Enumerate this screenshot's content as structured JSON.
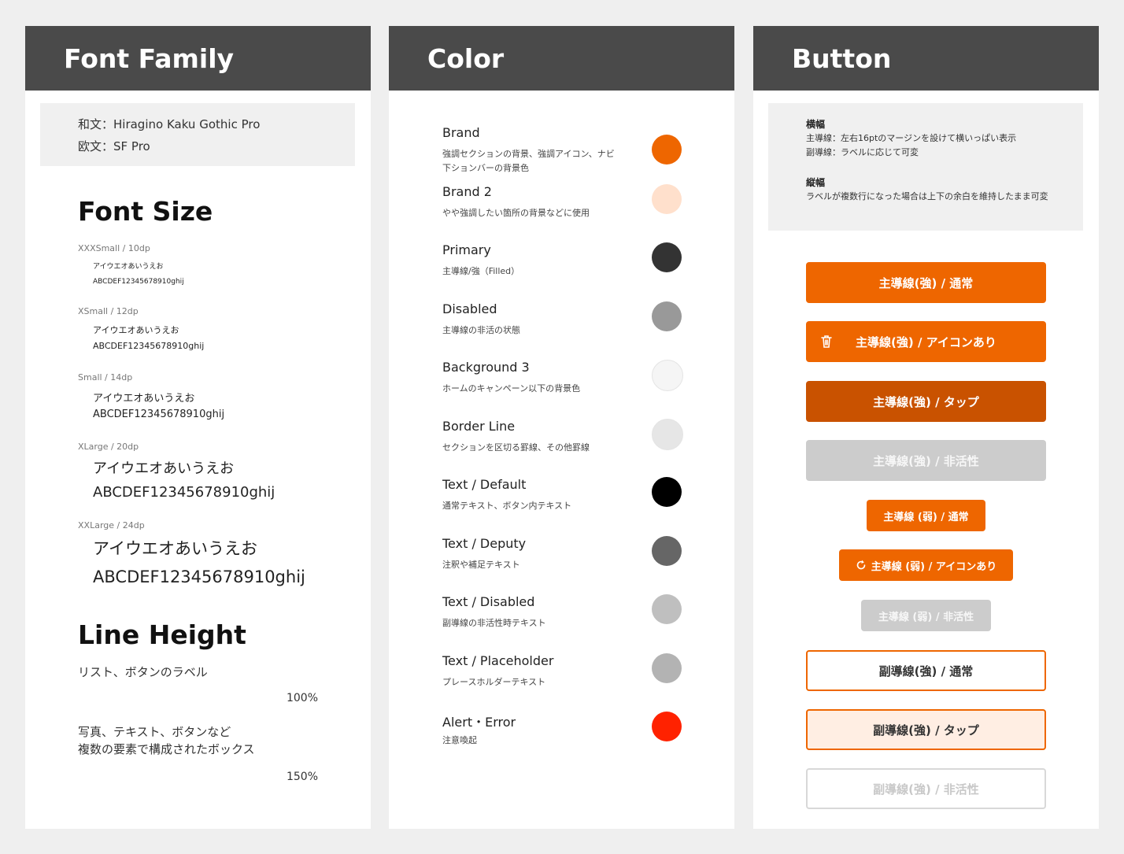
{
  "font_family": {
    "title": "Font Family",
    "japanese": "和文：Hiragino Kaku Gothic Pro",
    "latin": "欧文：SF Pro"
  },
  "font_size": {
    "title": "Font Size",
    "items": [
      {
        "label": "XXXSmall / 10dp",
        "kana": "アイウエオあいうえお",
        "alnum": "ABCDEF12345678910ghij"
      },
      {
        "label": "XSmall / 12dp",
        "kana": "アイウエオあいうえお",
        "alnum": "ABCDEF12345678910ghij"
      },
      {
        "label": "Small / 14dp",
        "kana": "アイウエオあいうえお",
        "alnum": "ABCDEF12345678910ghij"
      },
      {
        "label": "XLarge / 20dp",
        "kana": "アイウエオあいうえお",
        "alnum": "ABCDEF12345678910ghij"
      },
      {
        "label": "XXLarge / 24dp",
        "kana": "アイウエオあいうえお",
        "alnum": "ABCDEF12345678910ghij"
      }
    ]
  },
  "line_height": {
    "title": "Line Height",
    "items": [
      {
        "text1": "リスト、ボタンのラベル",
        "text2": "",
        "value": "100%"
      },
      {
        "text1": "写真、テキスト、ボタンなど",
        "text2": "複数の要素で構成されたボックス",
        "value": "150%"
      }
    ]
  },
  "color": {
    "title": "Color",
    "items": [
      {
        "name": "Brand",
        "desc": "強調セクションの背景、強調アイコン、ナビ下ションバーの背景色",
        "hex": "#ee6600"
      },
      {
        "name": "Brand 2",
        "desc": "やや強調したい箇所の背景などに使用",
        "hex": "#ffe0cc"
      },
      {
        "name": "Primary",
        "desc": "主導線/強（Filled）",
        "hex": "#333333"
      },
      {
        "name": "Disabled",
        "desc": "主導線の非活の状態",
        "hex": "#999999"
      },
      {
        "name": "Background 3",
        "desc": "ホームのキャンペーン以下の背景色",
        "hex": "#f5f5f5"
      },
      {
        "name": "Border Line",
        "desc": "セクションを区切る罫線、その他罫線",
        "hex": "#e6e6e6"
      },
      {
        "name": "Text / Default",
        "desc": "通常テキスト、ボタン内テキスト",
        "hex": "#000000"
      },
      {
        "name": "Text / Deputy",
        "desc": "注釈や補足テキスト",
        "hex": "#666666"
      },
      {
        "name": "Text / Disabled",
        "desc": "副導線の非活性時テキスト",
        "hex": "#bfbfbf"
      },
      {
        "name": "Text / Placeholder",
        "desc": "プレースホルダーテキスト",
        "hex": "#b3b3b3"
      },
      {
        "name": "Alert・Error",
        "desc": "注意喚起",
        "hex": "#ff2200"
      }
    ]
  },
  "button": {
    "title": "Button",
    "width_title": "横幅",
    "width_line1": "主導線：左右16ptのマージンを設けて横いっぱい表示",
    "width_line2": "副導線：ラベルに応じて可変",
    "height_title": "縦幅",
    "height_desc": "ラベルが複数行になった場合は上下の余白を維持したまま可変",
    "primary_normal": "主導線(強) / 通常",
    "primary_icon": "主導線(強) / アイコンあり",
    "primary_tap": "主導線(強) / タップ",
    "primary_disabled": "主導線(強) / 非活性",
    "weak_normal": "主導線 (弱) / 通常",
    "weak_icon": "主導線 (弱) / アイコンあり",
    "weak_disabled": "主導線 (弱) / 非活性",
    "secondary_normal": "副導線(強) / 通常",
    "secondary_tap": "副導線(強) / タップ",
    "secondary_disabled": "副導線(強) / 非活性"
  }
}
